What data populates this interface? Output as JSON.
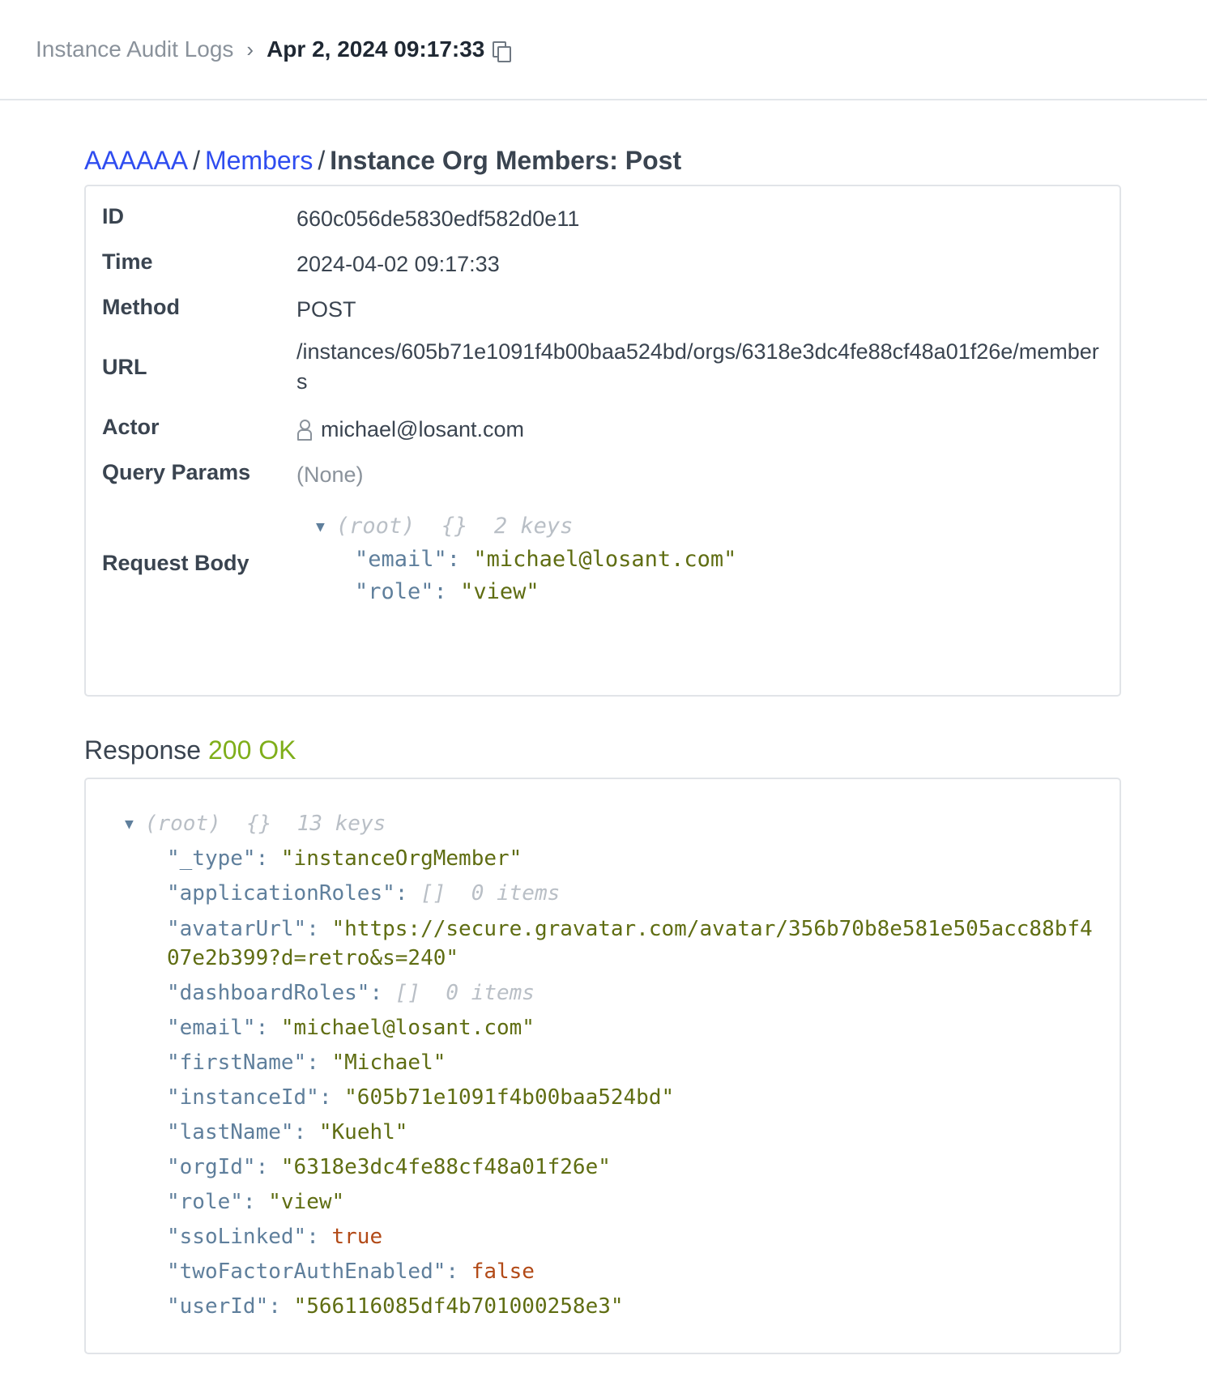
{
  "topbar": {
    "root_label": "Instance Audit Logs",
    "separator": "›",
    "current_label": "Apr 2, 2024 09:17:33",
    "copy_icon": "copy-icon"
  },
  "breadcrumb": {
    "org": "AAAAAA",
    "section": "Members",
    "title": "Instance Org Members: Post"
  },
  "details": {
    "id_label": "ID",
    "id_value": "660c056de5830edf582d0e11",
    "time_label": "Time",
    "time_value": "2024-04-02 09:17:33",
    "method_label": "Method",
    "method_value": "POST",
    "url_label": "URL",
    "url_value": "/instances/605b71e1091f4b00baa524bd/orgs/6318e3dc4fe88cf48a01f26e/members",
    "actor_label": "Actor",
    "actor_value": "michael@losant.com",
    "actor_icon": "person-icon",
    "query_label": "Query Params",
    "query_value": "(None)",
    "body_label": "Request Body"
  },
  "request_body": {
    "root_meta": "(root)  {}  2 keys",
    "lines": [
      {
        "key": "\"email\"",
        "value": "\"michael@losant.com\""
      },
      {
        "key": "\"role\"",
        "value": "\"view\""
      }
    ]
  },
  "response": {
    "heading": "Response",
    "status": "200 OK",
    "root_meta": "(root)  {}  13 keys",
    "lines": [
      {
        "key": "\"_type\"",
        "value": "\"instanceOrgMember\""
      },
      {
        "key": "\"applicationRoles\"",
        "meta": "[]  0 items"
      },
      {
        "key": "\"avatarUrl\"",
        "value": "\"https://secure.gravatar.com/avatar/356b70b8e581e505acc88bf407e2b399?d=retro&s=240\""
      },
      {
        "key": "\"dashboardRoles\"",
        "meta": "[]  0 items"
      },
      {
        "key": "\"email\"",
        "value": "\"michael@losant.com\""
      },
      {
        "key": "\"firstName\"",
        "value": "\"Michael\""
      },
      {
        "key": "\"instanceId\"",
        "value": "\"605b71e1091f4b00baa524bd\""
      },
      {
        "key": "\"lastName\"",
        "value": "\"Kuehl\""
      },
      {
        "key": "\"orgId\"",
        "value": "\"6318e3dc4fe88cf48a01f26e\""
      },
      {
        "key": "\"role\"",
        "value": "\"view\""
      },
      {
        "key": "\"ssoLinked\"",
        "bool": "true"
      },
      {
        "key": "\"twoFactorAuthEnabled\"",
        "bool": "false"
      },
      {
        "key": "\"userId\"",
        "value": "\"566116085df4b701000258e3\""
      }
    ]
  }
}
